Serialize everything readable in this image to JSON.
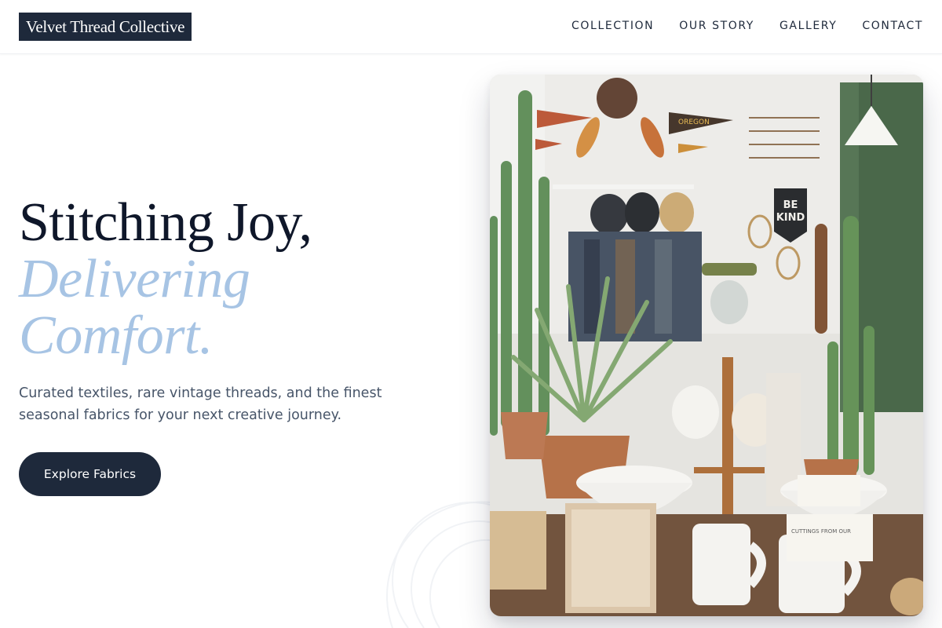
{
  "header": {
    "logo_text": "Velvet Thread Collective",
    "nav": [
      {
        "label": "COLLECTION"
      },
      {
        "label": "OUR STORY"
      },
      {
        "label": "GALLERY"
      },
      {
        "label": "CONTACT"
      }
    ]
  },
  "hero": {
    "title_line1": "Stitching Joy,",
    "title_accent_line1": "Delivering",
    "title_accent_line2": "Comfort.",
    "subtitle": "Curated textiles, rare vintage threads, and the finest seasonal fabrics for your next creative journey.",
    "cta_label": "Explore Fabrics"
  },
  "hero_image": {
    "pennant_text": "OREGON",
    "banner_text_line1": "BE",
    "banner_text_line2": "KIND",
    "card_text": "CUTTINGS FROM OUR",
    "icon": "shop-interior-photo"
  },
  "colors": {
    "brand_dark": "#1e293b",
    "accent_blue": "#a7c4e4",
    "text_muted": "#475569"
  }
}
